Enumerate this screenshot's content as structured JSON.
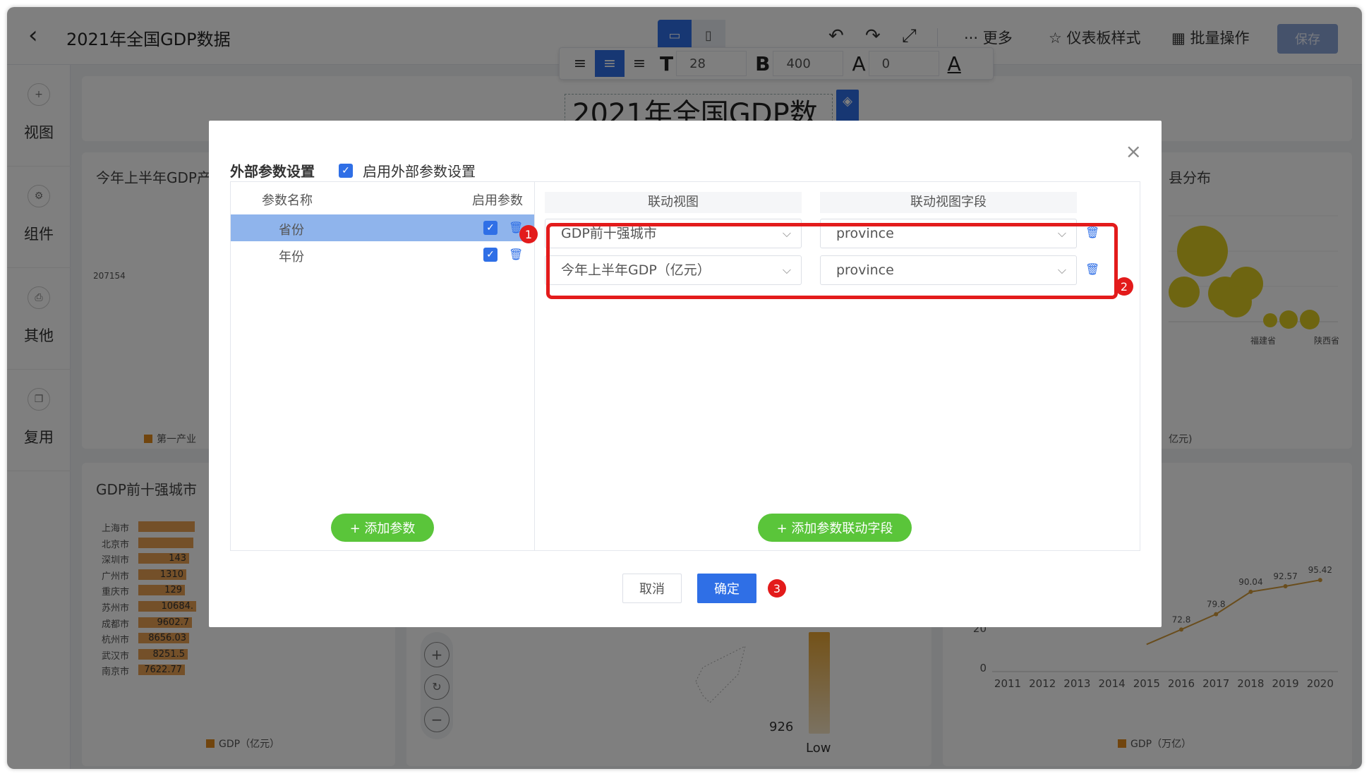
{
  "header": {
    "back_icon": "chevron-left-icon",
    "title": "2021年全国GDP数据",
    "more": "··· 更多",
    "dashboard_style": "仪表板样式",
    "batch_ops": "批量操作",
    "save": "保存"
  },
  "format_toolbar": {
    "font_size": "28",
    "font_weight": "400",
    "letter_spacing": "0"
  },
  "sidebar": {
    "items": [
      {
        "label": "视图",
        "icon": "plus-circle-icon"
      },
      {
        "label": "组件",
        "icon": "gear-icon"
      },
      {
        "label": "其他",
        "icon": "print-icon"
      },
      {
        "label": "复用",
        "icon": "copy-icon"
      }
    ]
  },
  "dashboard": {
    "title_text": "2021年全国GDP数",
    "panels": {
      "gdp_half_year": {
        "title": "今年上半年GDP产",
        "value_label": "207154",
        "legend": "第一产业"
      },
      "right_top": {
        "title": "县分布",
        "x_labels": [
          "福建省",
          "陕西省"
        ],
        "legend_fragment": "亿元)"
      },
      "top10": {
        "title": "GDP前十强城市",
        "cities": [
          "上海市",
          "北京市",
          "深圳市",
          "广州市",
          "重庆市",
          "苏州市",
          "成都市",
          "杭州市",
          "武汉市",
          "南京市"
        ],
        "values": [
          "",
          "",
          "143",
          "1310",
          "129",
          "10684.",
          "9602.7",
          "8656.03",
          "8251.5",
          "7622.77"
        ],
        "legend": "GDP（亿元）"
      },
      "map": {
        "min_value": "926",
        "low_label": "Low"
      },
      "trend": {
        "point_labels": [
          "72.8",
          "79.8",
          "90.04",
          "92.57",
          "95.42"
        ],
        "y_labels": [
          "20",
          "0"
        ],
        "x_labels": [
          "2011",
          "2012",
          "2013",
          "2014",
          "2015",
          "2016",
          "2017",
          "2018",
          "2019",
          "2020"
        ],
        "legend": "GDP（万亿）"
      }
    }
  },
  "modal": {
    "title": "外部参数设置",
    "enable_label": "启用外部参数设置",
    "left_col_name": "参数名称",
    "left_col_enable": "启用参数",
    "params": [
      {
        "name": "省份",
        "enabled": true,
        "selected": true
      },
      {
        "name": "年份",
        "enabled": true,
        "selected": false
      }
    ],
    "add_param": "+ 添加参数",
    "right_col_view": "联动视图",
    "right_col_field": "联动视图字段",
    "links": [
      {
        "view": "GDP前十强城市",
        "field": "province"
      },
      {
        "view": "今年上半年GDP（亿元）",
        "field": "province"
      }
    ],
    "add_link_field": "+ 添加参数联动字段",
    "cancel": "取消",
    "confirm": "确定",
    "badges": [
      "1",
      "2",
      "3"
    ]
  }
}
